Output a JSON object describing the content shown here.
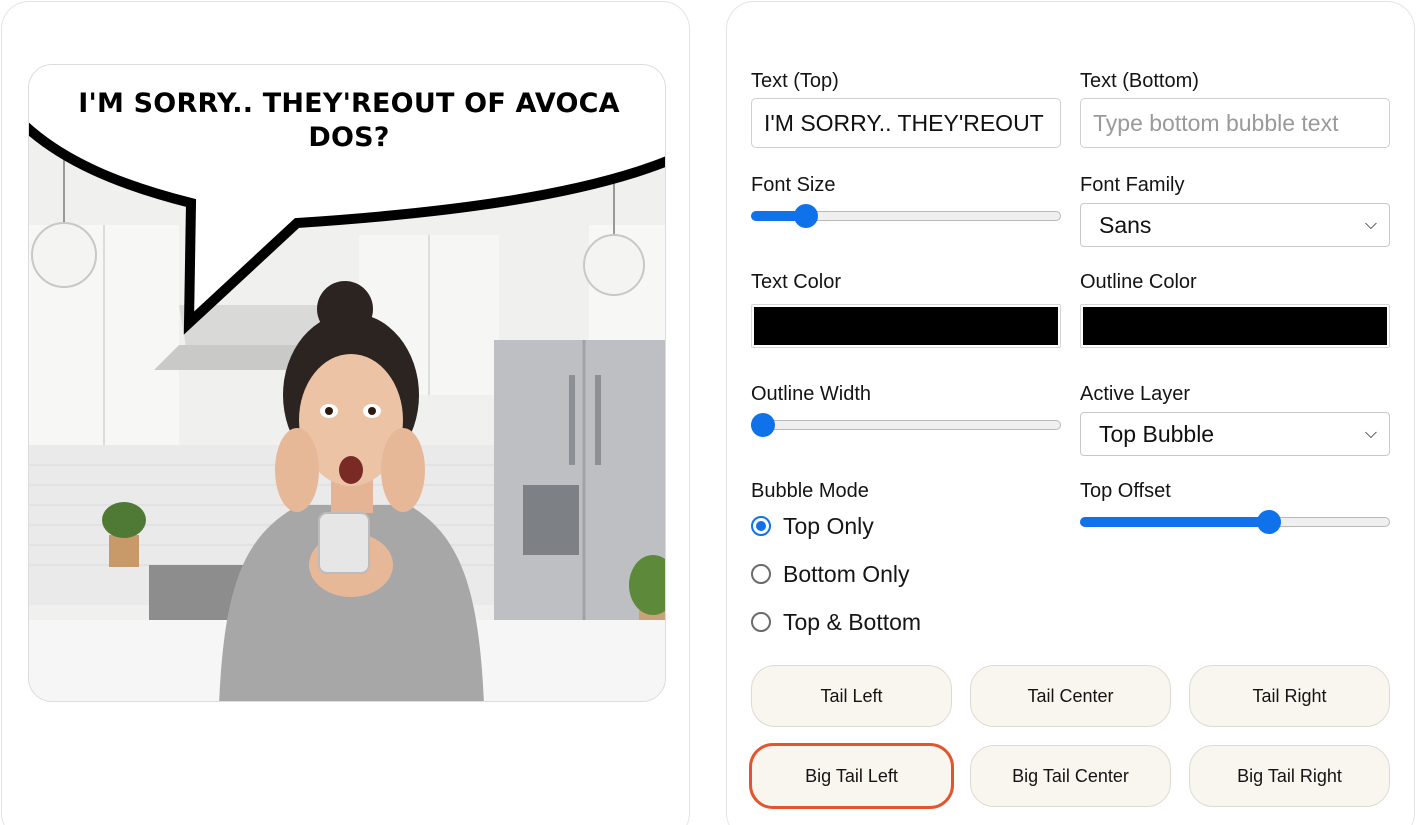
{
  "preview": {
    "bubble_text": "I'M SORRY.. THEY'REOUT OF AVOCADOS?"
  },
  "controls": {
    "text_top": {
      "label": "Text (Top)",
      "value": "I'M SORRY.. THEY'REOUT OF AVOCADOS?"
    },
    "text_bottom": {
      "label": "Text (Bottom)",
      "value": "",
      "placeholder": "Type bottom bubble text"
    },
    "font_size": {
      "label": "Font Size",
      "level": 0.15
    },
    "font_family": {
      "label": "Font Family",
      "selected": "Sans"
    },
    "text_color": {
      "label": "Text Color",
      "value": "#000000"
    },
    "outline_color": {
      "label": "Outline Color",
      "value": "#000000"
    },
    "outline_width": {
      "label": "Outline Width",
      "level": 0.0
    },
    "active_layer": {
      "label": "Active Layer",
      "selected": "Top Bubble"
    },
    "bubble_mode": {
      "label": "Bubble Mode",
      "options": [
        "Top Only",
        "Bottom Only",
        "Top & Bottom"
      ],
      "selected": "Top Only"
    },
    "top_offset": {
      "label": "Top Offset",
      "level": 0.62
    }
  },
  "tail_buttons": {
    "tail_left": "Tail Left",
    "tail_center": "Tail Center",
    "tail_right": "Tail Right",
    "big_tail_left": "Big Tail Left",
    "big_tail_center": "Big Tail Center",
    "big_tail_right": "Big Tail Right",
    "active": "Big Tail Left"
  },
  "colors": {
    "accent": "#0f72ea",
    "active_outline": "#e4552e",
    "button_bg": "#f9f6ef"
  }
}
